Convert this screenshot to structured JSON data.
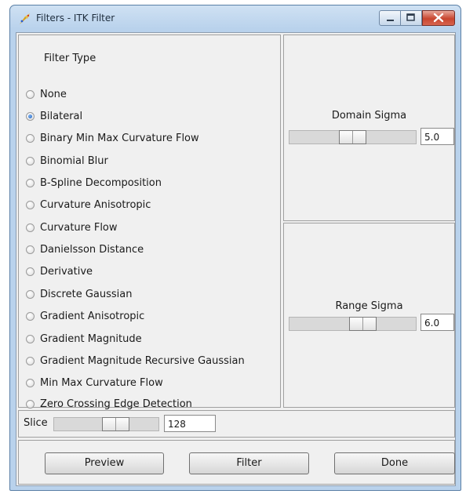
{
  "window": {
    "title": "Filters - ITK Filter"
  },
  "filter_type": {
    "legend": "Filter Type",
    "selected": "Bilateral",
    "options": [
      "None",
      "Bilateral",
      "Binary Min Max Curvature Flow",
      "Binomial Blur",
      "B-Spline Decomposition",
      "Curvature Anisotropic",
      "Curvature Flow",
      "Danielsson Distance",
      "Derivative",
      "Discrete Gaussian",
      "Gradient Anisotropic",
      "Gradient Magnitude",
      "Gradient Magnitude Recursive Gaussian",
      "Min Max Curvature Flow",
      "Zero Crossing Edge Detection"
    ]
  },
  "domain_sigma": {
    "label": "Domain Sigma",
    "value": "5.0"
  },
  "range_sigma": {
    "label": "Range Sigma",
    "value": "6.0"
  },
  "slice": {
    "label": "Slice",
    "value": "128"
  },
  "buttons": {
    "preview": "Preview",
    "filter": "Filter",
    "done": "Done"
  },
  "colors": {
    "titlebar": "#b9d2ec",
    "close_button": "#c8452f",
    "panel_bg": "#f0f0f0"
  }
}
